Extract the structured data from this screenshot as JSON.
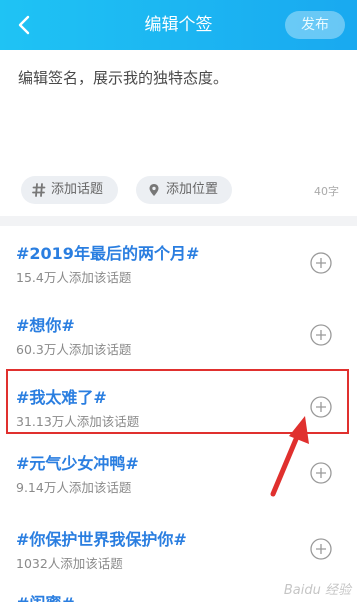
{
  "header": {
    "title": "编辑个签",
    "publish_label": "发布"
  },
  "editor": {
    "placeholder": "编辑签名，展示我的独特态度。",
    "add_topic_label": "添加话题",
    "add_location_label": "添加位置",
    "char_count": "40字"
  },
  "topics": [
    {
      "name": "#2019年最后的两个月#",
      "count": "15.4万人添加该话题"
    },
    {
      "name": "#想你#",
      "count": "60.3万人添加该话题"
    },
    {
      "name": "#我太难了#",
      "count": "31.13万人添加该话题"
    },
    {
      "name": "#元气少女冲鸭#",
      "count": "9.14万人添加该话题"
    },
    {
      "name": "#你保护世界我保护你#",
      "count": "1032人添加该话题"
    },
    {
      "name": "#闺蜜#",
      "count": ""
    }
  ],
  "highlighted_topic_index": 2,
  "watermark": "Baidu 经验",
  "colors": {
    "header_gradient_start": "#1fc3f4",
    "header_gradient_end": "#19a9f0",
    "topic_text": "#2a7ee0",
    "highlight_border": "#e0302e"
  }
}
